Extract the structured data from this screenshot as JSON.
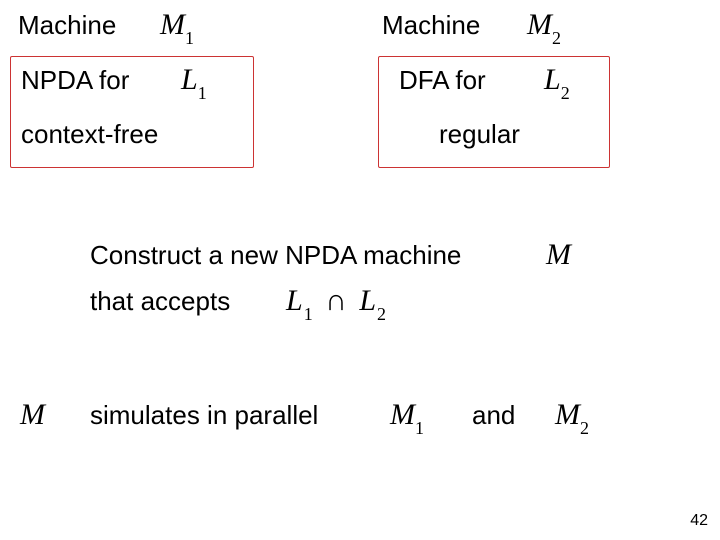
{
  "top": {
    "left_label": "Machine",
    "left_math_M": "M",
    "left_math_sub": "1",
    "right_label": "Machine",
    "right_math_M": "M",
    "right_math_sub": "2"
  },
  "box_left": {
    "line1_a": "NPDA  for",
    "line1_math_L": "L",
    "line1_math_sub": "1",
    "line2": "context-free"
  },
  "box_right": {
    "line1_a": "DFA  for",
    "line1_math_L": "L",
    "line1_math_sub": "2",
    "line2": "regular"
  },
  "mid": {
    "line1": "Construct a new NPDA machine",
    "line2_a": "that accepts",
    "line2_math_L1_L": "L",
    "line2_math_L1_sub": "1",
    "line2_math_cap": "∩",
    "line2_math_L2_L": "L",
    "line2_math_L2_sub": "2",
    "line1_end_M": "M"
  },
  "bottom": {
    "pre_M": "M",
    "text": "simulates in parallel",
    "m1_M": "M",
    "m1_sub": "1",
    "and": "and",
    "m2_M": "M",
    "m2_sub": "2"
  },
  "page_number": "42"
}
